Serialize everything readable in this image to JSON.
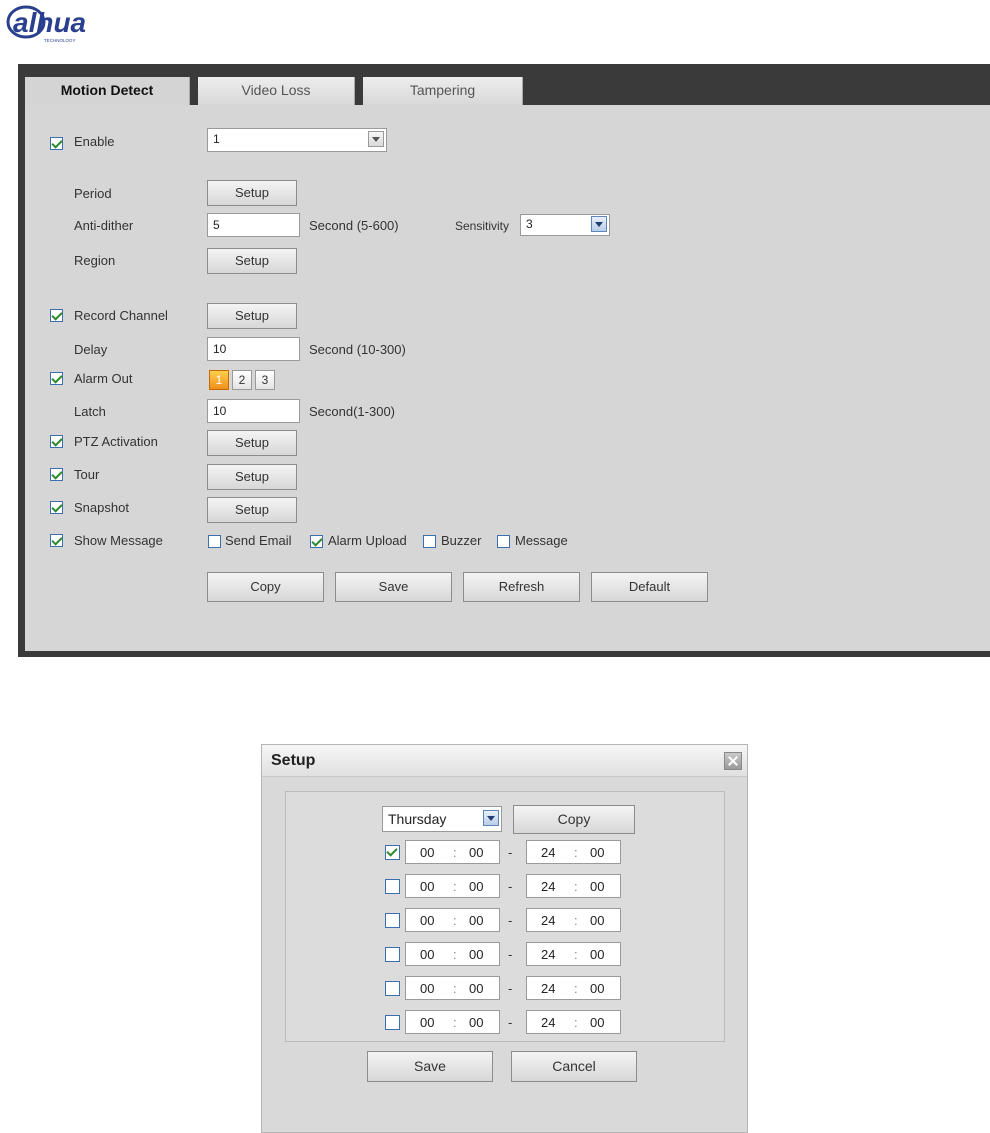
{
  "logo": {
    "text": "alhua",
    "subtext": "TECHNOLOGY"
  },
  "tabs": [
    {
      "label": "Motion Detect",
      "active": true
    },
    {
      "label": "Video Loss",
      "active": false
    },
    {
      "label": "Tampering",
      "active": false
    }
  ],
  "form": {
    "enable": {
      "label": "Enable",
      "checked": true,
      "channel_value": "1"
    },
    "period": {
      "label": "Period",
      "button": "Setup"
    },
    "anti_dither": {
      "label": "Anti-dither",
      "value": "5",
      "unit": "Second (5-600)"
    },
    "sensitivity": {
      "label": "Sensitivity",
      "value": "3"
    },
    "region": {
      "label": "Region",
      "button": "Setup"
    },
    "record_channel": {
      "label": "Record Channel",
      "checked": true,
      "button": "Setup"
    },
    "delay": {
      "label": "Delay",
      "value": "10",
      "unit": "Second (10-300)"
    },
    "alarm_out": {
      "label": "Alarm Out",
      "checked": true,
      "options": [
        "1",
        "2",
        "3"
      ],
      "selected": "1"
    },
    "latch": {
      "label": "Latch",
      "value": "10",
      "unit": "Second(1-300)"
    },
    "ptz_activation": {
      "label": "PTZ Activation",
      "checked": true,
      "button": "Setup"
    },
    "tour": {
      "label": "Tour",
      "checked": true,
      "button": "Setup"
    },
    "snapshot": {
      "label": "Snapshot",
      "checked": true,
      "button": "Setup"
    },
    "show_message": {
      "label": "Show Message",
      "checked": true,
      "send_email": {
        "label": "Send Email",
        "checked": false
      },
      "alarm_upload": {
        "label": "Alarm Upload",
        "checked": true
      },
      "buzzer": {
        "label": "Buzzer",
        "checked": false
      },
      "message": {
        "label": "Message",
        "checked": false
      }
    }
  },
  "actions": {
    "copy": "Copy",
    "save": "Save",
    "refresh": "Refresh",
    "default": "Default"
  },
  "dialog": {
    "title": "Setup",
    "day": "Thursday",
    "copy": "Copy",
    "periods": [
      {
        "enabled": true,
        "start_h": "00",
        "start_m": "00",
        "end_h": "24",
        "end_m": "00"
      },
      {
        "enabled": false,
        "start_h": "00",
        "start_m": "00",
        "end_h": "24",
        "end_m": "00"
      },
      {
        "enabled": false,
        "start_h": "00",
        "start_m": "00",
        "end_h": "24",
        "end_m": "00"
      },
      {
        "enabled": false,
        "start_h": "00",
        "start_m": "00",
        "end_h": "24",
        "end_m": "00"
      },
      {
        "enabled": false,
        "start_h": "00",
        "start_m": "00",
        "end_h": "24",
        "end_m": "00"
      },
      {
        "enabled": false,
        "start_h": "00",
        "start_m": "00",
        "end_h": "24",
        "end_m": "00"
      }
    ],
    "separator": ":",
    "dash": "-",
    "save": "Save",
    "cancel": "Cancel"
  },
  "colors": {
    "brand": "#2b3f8f",
    "panel": "#3a3a3a",
    "content": "#d6d6d6",
    "highlight": "#f18f1a"
  }
}
